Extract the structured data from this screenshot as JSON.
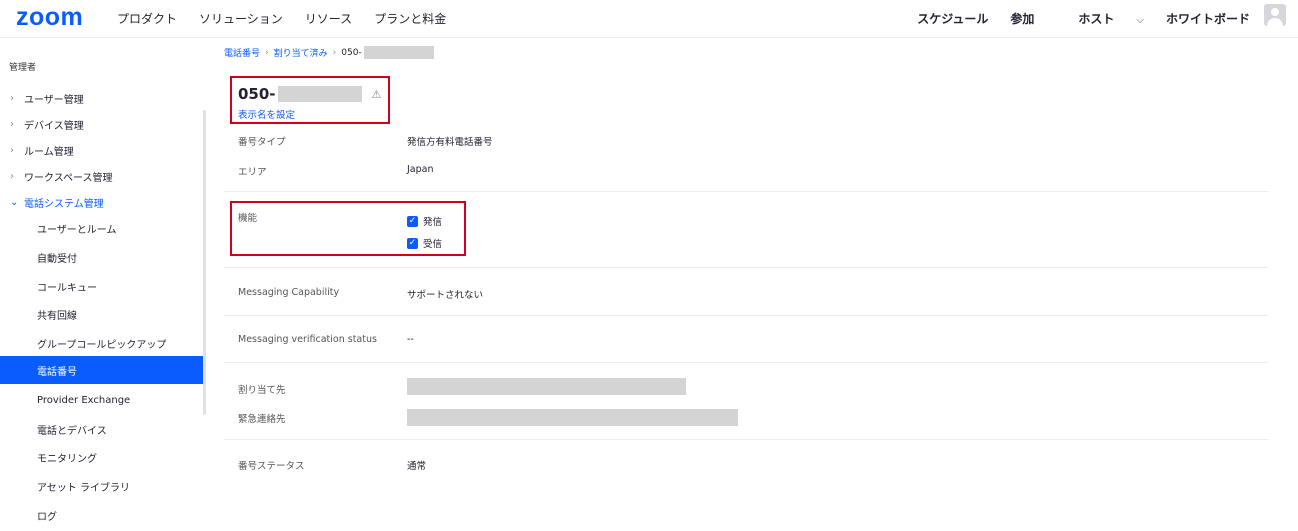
{
  "topbar": {
    "logo": "zoom",
    "nav_left": [
      "プロダクト",
      "ソリューション",
      "リソース",
      "プランと料金"
    ],
    "nav_right": {
      "schedule": "スケジュール",
      "join": "参加",
      "host": "ホスト",
      "whiteboard": "ホワイトボード"
    }
  },
  "sidebar": {
    "admin_label": "管理者",
    "groups": [
      {
        "label": "ユーザー管理"
      },
      {
        "label": "デバイス管理"
      },
      {
        "label": "ルーム管理"
      },
      {
        "label": "ワークスペース管理"
      },
      {
        "label": "電話システム管理"
      }
    ],
    "sub_items": [
      {
        "label": "ユーザーとルーム"
      },
      {
        "label": "自動受付"
      },
      {
        "label": "コールキュー"
      },
      {
        "label": "共有回線"
      },
      {
        "label": "グループコールピックアップ"
      },
      {
        "label": "電話番号"
      },
      {
        "label": "Provider Exchange"
      },
      {
        "label": "電話とデバイス"
      },
      {
        "label": "モニタリング"
      },
      {
        "label": "アセット ライブラリ"
      },
      {
        "label": "ログ"
      }
    ]
  },
  "breadcrumb": {
    "items": [
      "電話番号",
      "割り当て済み"
    ],
    "current": "050-"
  },
  "number": {
    "title": "050-",
    "set_display_name": "表示名を設定"
  },
  "details": {
    "number_type_label": "番号タイプ",
    "number_type_value": "発信方有料電話番号",
    "area_label": "エリア",
    "area_value": "Japan",
    "capability_label": "機能",
    "capability_outgoing": "発信",
    "capability_incoming": "受信",
    "messaging_capability_label": "Messaging Capability",
    "messaging_capability_value": "サポートされない",
    "messaging_verification_label": "Messaging verification status",
    "messaging_verification_value": "--",
    "assigned_to_label": "割り当て先",
    "emergency_address_label": "緊急連絡先",
    "number_status_label": "番号ステータス",
    "number_status_value": "通常"
  },
  "colors": {
    "accent": "#0b5cff",
    "highlight": "#d0021b"
  }
}
